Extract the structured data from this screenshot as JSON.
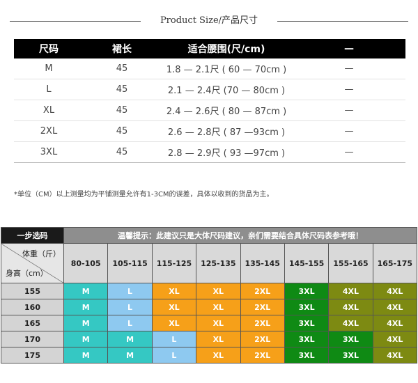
{
  "title": "Product Size/产品尺寸",
  "size_table": {
    "headers": [
      "尺码",
      "裙长",
      "适合腰围(尺/cm)",
      "—"
    ],
    "rows": [
      [
        "M",
        "45",
        "1.8 — 2.1尺 ( 60 — 70cm )",
        "—"
      ],
      [
        "L",
        "45",
        "2.1 — 2.4尺 (70 — 80cm )",
        "—"
      ],
      [
        "XL",
        "45",
        "2.4 — 2.6尺 ( 80 — 87cm )",
        "—"
      ],
      [
        "2XL",
        "45",
        "2.6 — 2.8尺 ( 87 —93cm )",
        "—"
      ],
      [
        "3XL",
        "45",
        "2.8 — 2.9尺 ( 93 —97cm )",
        "—"
      ]
    ]
  },
  "note": "*单位（CM）以上测量均为平铺测量允许有1-3CM的误差，具体以收到的货品为主。",
  "recommend": {
    "corner_title": "一步选码",
    "tip": "温馨提示：此建议只是大体尺码建议，亲们需要结合具体尺码表参考哦！",
    "weight_label": "体重（斤）",
    "height_label": "身高（cm）",
    "weights": [
      "80-105",
      "105-115",
      "115-125",
      "125-135",
      "135-145",
      "145-155",
      "155-165",
      "165-175"
    ],
    "rows": [
      {
        "height": "155",
        "cells": [
          "M",
          "L",
          "XL",
          "XL",
          "2XL",
          "3XL",
          "4XL",
          "4XL"
        ]
      },
      {
        "height": "160",
        "cells": [
          "M",
          "L",
          "XL",
          "XL",
          "2XL",
          "3XL",
          "4XL",
          "4XL"
        ]
      },
      {
        "height": "165",
        "cells": [
          "M",
          "L",
          "XL",
          "XL",
          "2XL",
          "3XL",
          "4XL",
          "4XL"
        ]
      },
      {
        "height": "170",
        "cells": [
          "M",
          "M",
          "L",
          "XL",
          "2XL",
          "3XL",
          "3XL",
          "4XL"
        ]
      },
      {
        "height": "175",
        "cells": [
          "M",
          "M",
          "L",
          "XL",
          "2XL",
          "3XL",
          "3XL",
          "4XL"
        ]
      }
    ],
    "colors": {
      "M": "#35c8c3",
      "L": "#8ec9f0",
      "XL": "#f6a019",
      "2XL": "#f6a019",
      "3XL": "#0f8a14",
      "4XL": "#7d8a12"
    }
  }
}
